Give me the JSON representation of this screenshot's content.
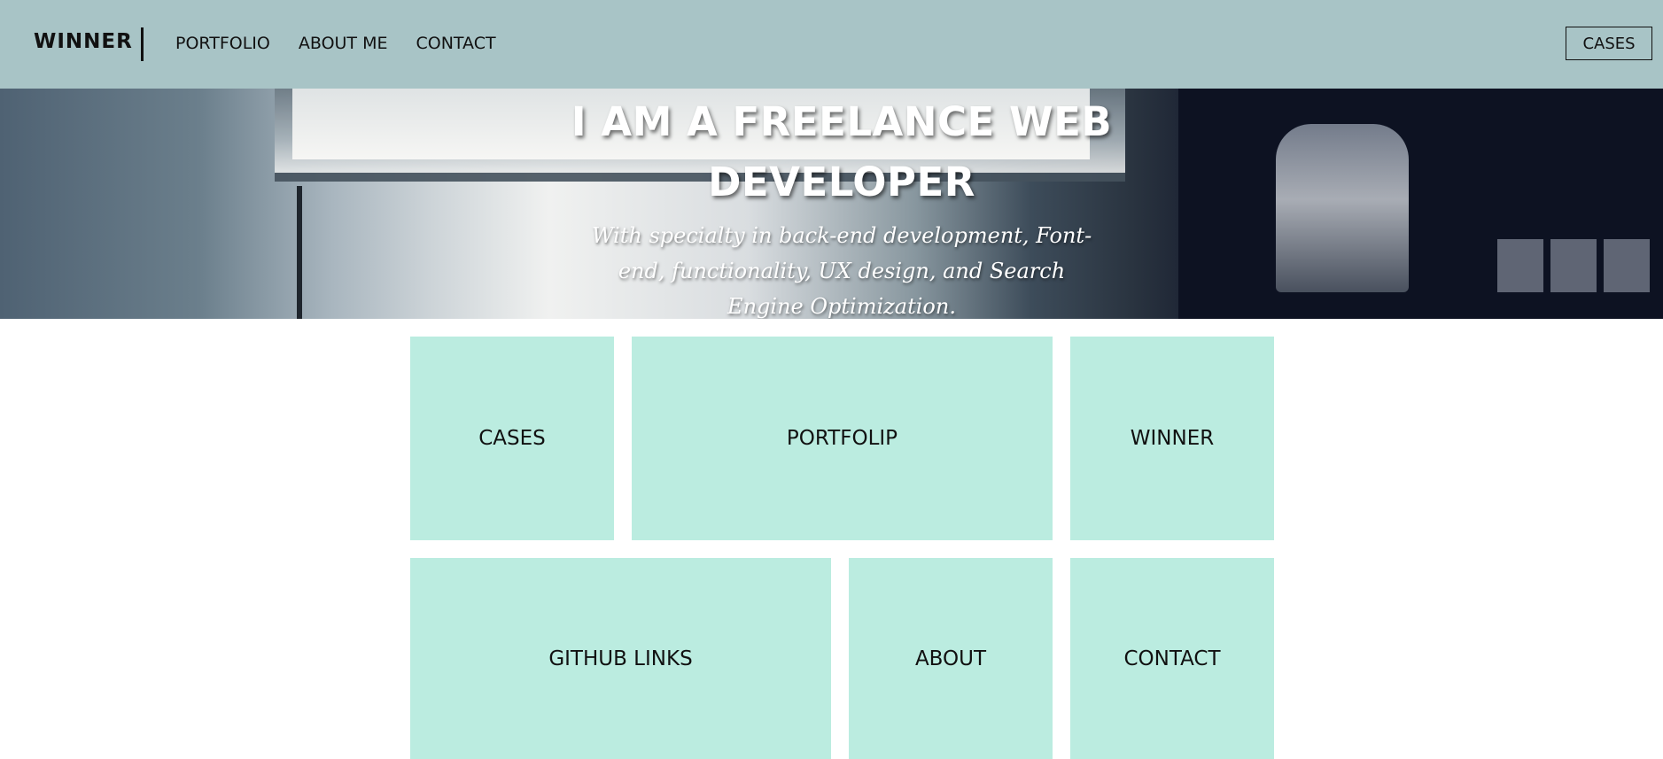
{
  "navbar": {
    "brand": "WINNER",
    "links": [
      "PORTFOLIO",
      "ABOUT ME",
      "CONTACT"
    ],
    "cta_label": "CASES",
    "background": "#a8c4c6"
  },
  "hero": {
    "title_line1": "I AM A FREELANCE WEB",
    "title_line2": "DEVELOPER",
    "subtitle": "With specialty in back-end development, Font-end, functionality, UX design, and Search Engine Optimization."
  },
  "tiles": {
    "color": "#bbece0",
    "labels": [
      "CASES",
      "PORTFOLIP",
      "WINNER",
      "GITHUB LINKS",
      "ABOUT",
      "CONTACT"
    ]
  }
}
